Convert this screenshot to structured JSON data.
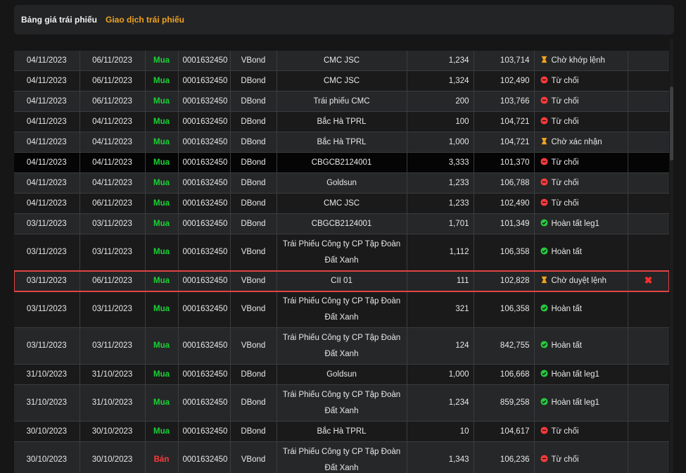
{
  "tabs": {
    "prices": "Bảng giá trái phiếu",
    "trading": "Giao dịch trái phiếu"
  },
  "colors": {
    "accent": "#f0a31f",
    "buy": "#19d336",
    "sell": "#ff3b3b",
    "highlight_border": "#e04545"
  },
  "rows": [
    {
      "trade_date": "04/11/2023",
      "settle_date": "06/11/2023",
      "side": "Mua",
      "account": "0001632450",
      "product": "VBond",
      "bond": "CMC JSC",
      "qty": "1,234",
      "price": "103,714",
      "status": "Chờ khớp lệnh",
      "status_icon": "hourglass-icon",
      "tall": false,
      "style": "odd",
      "highlight": false,
      "cancel": ""
    },
    {
      "trade_date": "04/11/2023",
      "settle_date": "06/11/2023",
      "side": "Mua",
      "account": "0001632450",
      "product": "DBond",
      "bond": "CMC JSC",
      "qty": "1,324",
      "price": "102,490",
      "status": "Từ chối",
      "status_icon": "reject-icon",
      "tall": false,
      "style": "even",
      "highlight": false,
      "cancel": ""
    },
    {
      "trade_date": "04/11/2023",
      "settle_date": "06/11/2023",
      "side": "Mua",
      "account": "0001632450",
      "product": "DBond",
      "bond": "Trái phiếu CMC",
      "qty": "200",
      "price": "103,766",
      "status": "Từ chối",
      "status_icon": "reject-icon",
      "tall": false,
      "style": "odd",
      "highlight": false,
      "cancel": ""
    },
    {
      "trade_date": "04/11/2023",
      "settle_date": "04/11/2023",
      "side": "Mua",
      "account": "0001632450",
      "product": "DBond",
      "bond": "Bắc Hà TPRL",
      "qty": "100",
      "price": "104,721",
      "status": "Từ chối",
      "status_icon": "reject-icon",
      "tall": false,
      "style": "even",
      "highlight": false,
      "cancel": ""
    },
    {
      "trade_date": "04/11/2023",
      "settle_date": "04/11/2023",
      "side": "Mua",
      "account": "0001632450",
      "product": "DBond",
      "bond": "Bắc Hà TPRL",
      "qty": "1,000",
      "price": "104,721",
      "status": "Chờ xác nhận",
      "status_icon": "hourglass-icon",
      "tall": false,
      "style": "odd",
      "highlight": false,
      "cancel": ""
    },
    {
      "trade_date": "04/11/2023",
      "settle_date": "04/11/2023",
      "side": "Mua",
      "account": "0001632450",
      "product": "DBond",
      "bond": "CBGCB2124001",
      "qty": "3,333",
      "price": "101,370",
      "status": "Từ chối",
      "status_icon": "reject-icon",
      "tall": false,
      "style": "dark",
      "highlight": false,
      "cancel": ""
    },
    {
      "trade_date": "04/11/2023",
      "settle_date": "04/11/2023",
      "side": "Mua",
      "account": "0001632450",
      "product": "DBond",
      "bond": "Goldsun",
      "qty": "1,233",
      "price": "106,788",
      "status": "Từ chối",
      "status_icon": "reject-icon",
      "tall": false,
      "style": "odd",
      "highlight": false,
      "cancel": ""
    },
    {
      "trade_date": "04/11/2023",
      "settle_date": "06/11/2023",
      "side": "Mua",
      "account": "0001632450",
      "product": "DBond",
      "bond": "CMC JSC",
      "qty": "1,233",
      "price": "102,490",
      "status": "Từ chối",
      "status_icon": "reject-icon",
      "tall": false,
      "style": "even",
      "highlight": false,
      "cancel": ""
    },
    {
      "trade_date": "03/11/2023",
      "settle_date": "03/11/2023",
      "side": "Mua",
      "account": "0001632450",
      "product": "DBond",
      "bond": "CBGCB2124001",
      "qty": "1,701",
      "price": "101,349",
      "status": "Hoàn tất leg1",
      "status_icon": "check-icon",
      "tall": false,
      "style": "odd",
      "highlight": false,
      "cancel": ""
    },
    {
      "trade_date": "03/11/2023",
      "settle_date": "03/11/2023",
      "side": "Mua",
      "account": "0001632450",
      "product": "VBond",
      "bond": "Trái Phiếu Công ty CP Tập Đoàn Đất Xanh",
      "qty": "1,112",
      "price": "106,358",
      "status": "Hoàn tất",
      "status_icon": "check-icon",
      "tall": true,
      "style": "even",
      "highlight": false,
      "cancel": ""
    },
    {
      "trade_date": "03/11/2023",
      "settle_date": "06/11/2023",
      "side": "Mua",
      "account": "0001632450",
      "product": "VBond",
      "bond": "CII 01",
      "qty": "111",
      "price": "102,828",
      "status": "Chờ duyệt lệnh",
      "status_icon": "hourglass-icon",
      "tall": false,
      "style": "hl",
      "highlight": true,
      "cancel": "✖"
    },
    {
      "trade_date": "03/11/2023",
      "settle_date": "03/11/2023",
      "side": "Mua",
      "account": "0001632450",
      "product": "VBond",
      "bond": "Trái Phiếu Công ty CP Tập Đoàn Đất Xanh",
      "qty": "321",
      "price": "106,358",
      "status": "Hoàn tất",
      "status_icon": "check-icon",
      "tall": true,
      "style": "even",
      "highlight": false,
      "cancel": ""
    },
    {
      "trade_date": "03/11/2023",
      "settle_date": "03/11/2023",
      "side": "Mua",
      "account": "0001632450",
      "product": "VBond",
      "bond": "Trái Phiếu Công ty CP Tập Đoàn Đất Xanh",
      "qty": "124",
      "price": "842,755",
      "status": "Hoàn tất",
      "status_icon": "check-icon",
      "tall": true,
      "style": "odd",
      "highlight": false,
      "cancel": ""
    },
    {
      "trade_date": "31/10/2023",
      "settle_date": "31/10/2023",
      "side": "Mua",
      "account": "0001632450",
      "product": "DBond",
      "bond": "Goldsun",
      "qty": "1,000",
      "price": "106,668",
      "status": "Hoàn tất leg1",
      "status_icon": "check-icon",
      "tall": false,
      "style": "even",
      "highlight": false,
      "cancel": ""
    },
    {
      "trade_date": "31/10/2023",
      "settle_date": "31/10/2023",
      "side": "Mua",
      "account": "0001632450",
      "product": "DBond",
      "bond": "Trái Phiếu Công ty CP Tập Đoàn Đất Xanh",
      "qty": "1,234",
      "price": "859,258",
      "status": "Hoàn tất leg1",
      "status_icon": "check-icon",
      "tall": true,
      "style": "odd",
      "highlight": false,
      "cancel": ""
    },
    {
      "trade_date": "30/10/2023",
      "settle_date": "30/10/2023",
      "side": "Mua",
      "account": "0001632450",
      "product": "DBond",
      "bond": "Bắc Hà TPRL",
      "qty": "10",
      "price": "104,617",
      "status": "Từ chối",
      "status_icon": "reject-icon",
      "tall": false,
      "style": "even",
      "highlight": false,
      "cancel": ""
    },
    {
      "trade_date": "30/10/2023",
      "settle_date": "30/10/2023",
      "side": "Bán",
      "account": "0001632450",
      "product": "VBond",
      "bond": "Trái Phiếu Công ty CP Tập Đoàn Đất Xanh",
      "qty": "1,343",
      "price": "106,236",
      "status": "Từ chối",
      "status_icon": "reject-icon",
      "tall": true,
      "style": "odd",
      "highlight": false,
      "cancel": ""
    }
  ]
}
